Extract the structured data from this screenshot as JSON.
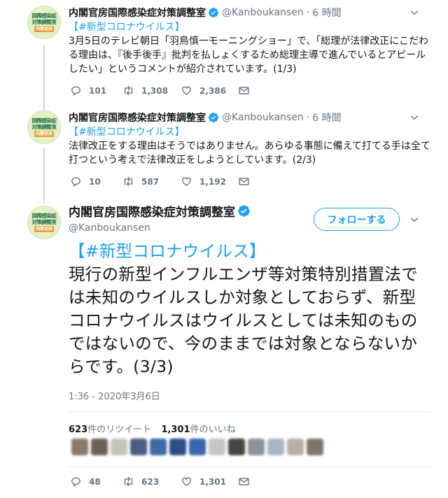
{
  "account": {
    "name": "内閣官房国際感染症対策調整室",
    "handle": "@Kanboukansen",
    "avatar_lines": [
      "国際感染症",
      "対策調整室"
    ],
    "avatar_badge": "内閣官房"
  },
  "tweets": [
    {
      "time": "6 時間",
      "tag": "【#新型コロナウイルス】",
      "body": "3月5日のテレビ朝日「羽鳥慎一モーニングショー」で、「総理が法律改正にこだわる理由は、『後手後手』批判を払しょくするため総理主導で進んでいるとアピールしたい」というコメントが紹介されています。(1/3)",
      "replies": "101",
      "retweets": "1,308",
      "likes": "2,386"
    },
    {
      "time": "6 時間",
      "tag": "【#新型コロナウイルス】",
      "body": "法律改正をする理由はそうではありません。あらゆる事態に備えて打てる手は全て打つという考えで法律改正をしようとしています。(2/3)",
      "replies": "10",
      "retweets": "587",
      "likes": "1,192"
    }
  ],
  "main": {
    "follow_label": "フォローする",
    "tag": "【#新型コロナウイルス】",
    "body": "現行の新型インフルエンザ等対策特別措置法では未知のウイルスしか対象としておらず、新型コロナウイルスはウイルスとしては未知のものではないので、今のままでは対象とならないからです。(3/3)",
    "timestamp": "1:36 - 2020年3月6日",
    "retweet_count": "623",
    "retweet_label": "件のリツイート",
    "like_count": "1,301",
    "like_label": "件のいいね",
    "replies": "48",
    "retweets": "623",
    "likes": "1,301"
  },
  "liker_colors": [
    "#8a7a6a",
    "#6b6255",
    "#c9c4bb",
    "#4a5e82",
    "#3d6aa8",
    "#2b4f86",
    "#3a66b0",
    "#c9c6c2",
    "#4a4440",
    "#8e939a",
    "#a9b5c7",
    "#b7b0a6",
    "#7f7669"
  ],
  "colors": {
    "accent": "#1da1f2",
    "text": "#14171a",
    "muted": "#657786"
  }
}
